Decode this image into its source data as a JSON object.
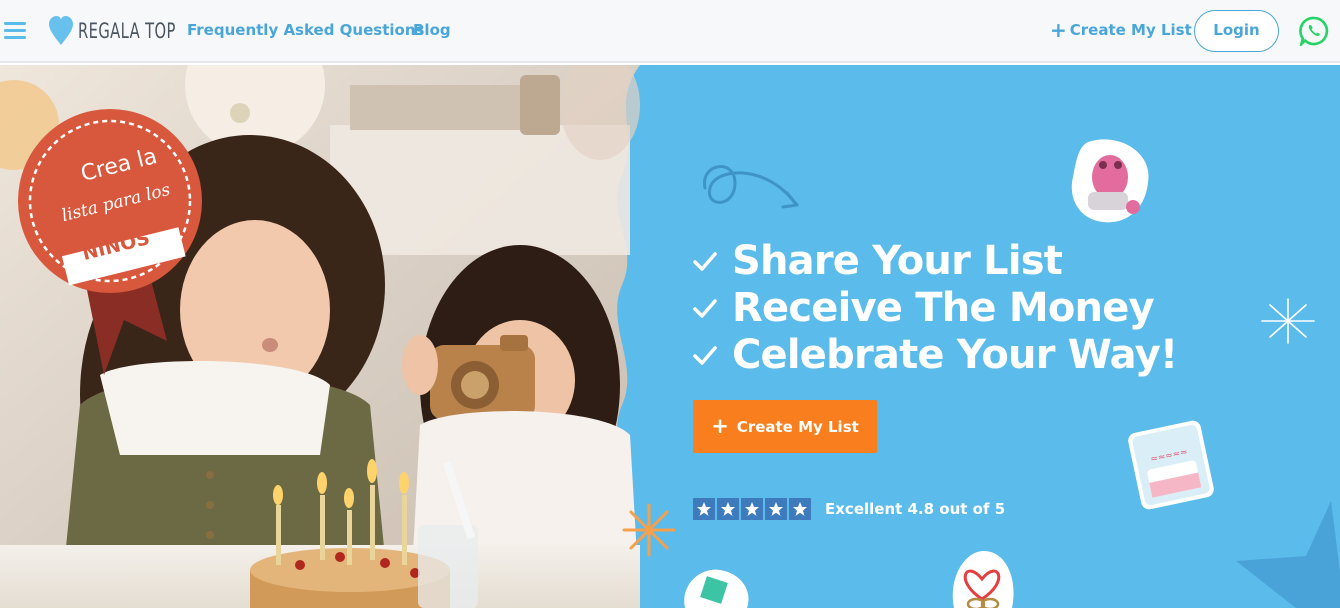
{
  "header": {
    "logo_text": "REGALA TOP",
    "nav": {
      "faq": "Frequently Asked Questions",
      "blog": "Blog"
    },
    "create_list": "Create My List",
    "login": "Login",
    "icons": [
      "hamburger-menu-icon",
      "heart-logo-icon",
      "plus-icon",
      "whatsapp-icon"
    ]
  },
  "hero": {
    "badge": {
      "line1": "Crea la",
      "line2": "lista para los",
      "line3": "NIÑOS"
    },
    "checks": [
      "Share Your List",
      "Receive The Money",
      "Celebrate Your Way!"
    ],
    "cta": "Create My List",
    "rating": {
      "stars": 5,
      "text": "Excellent 4.8 out of 5"
    }
  },
  "colors": {
    "brand_blue": "#5bbbea",
    "link_blue": "#4aa6d9",
    "cta_orange": "#f97e1e",
    "badge_red": "#d8583d",
    "star_blue": "#3e7bbd",
    "whatsapp_green": "#25d366"
  }
}
